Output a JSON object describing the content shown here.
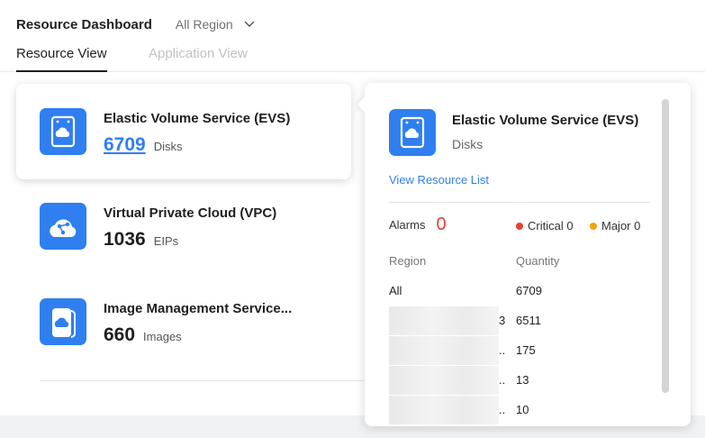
{
  "header": {
    "title": "Resource Dashboard",
    "region_select": "All Region"
  },
  "tabs": [
    {
      "label": "Resource View",
      "active": true
    },
    {
      "label": "Application View",
      "active": false
    }
  ],
  "cards": [
    {
      "name": "Elastic Volume Service (EVS)",
      "count": "6709",
      "unit": "Disks",
      "icon": "evs-disk-icon",
      "selected": true
    },
    {
      "name": "Virtual Private Cloud (VPC)",
      "count": "1036",
      "unit": "EIPs",
      "icon": "vpc-cloud-icon",
      "selected": false
    },
    {
      "name": "Image Management Service...",
      "count": "660",
      "unit": "Images",
      "icon": "ims-image-icon",
      "selected": false
    }
  ],
  "popover": {
    "title": "Elastic Volume Service (EVS)",
    "subtitle": "Disks",
    "view_link": "View Resource List",
    "alarms_label": "Alarms",
    "alarms_count": "0",
    "critical_label": "Critical 0",
    "major_label": "Major 0",
    "col_region": "Region",
    "col_quantity": "Quantity",
    "rows": [
      {
        "region": "All",
        "quantity": "6709"
      },
      {
        "region": "3",
        "quantity": "6511"
      },
      {
        "region": "..",
        "quantity": "175"
      },
      {
        "region": "..",
        "quantity": "13"
      },
      {
        "region": "..",
        "quantity": "10"
      }
    ]
  },
  "colors": {
    "accent": "#2f7ff0",
    "alarm": "#e8402f",
    "critical": "#e8402f",
    "major": "#f5a100"
  }
}
